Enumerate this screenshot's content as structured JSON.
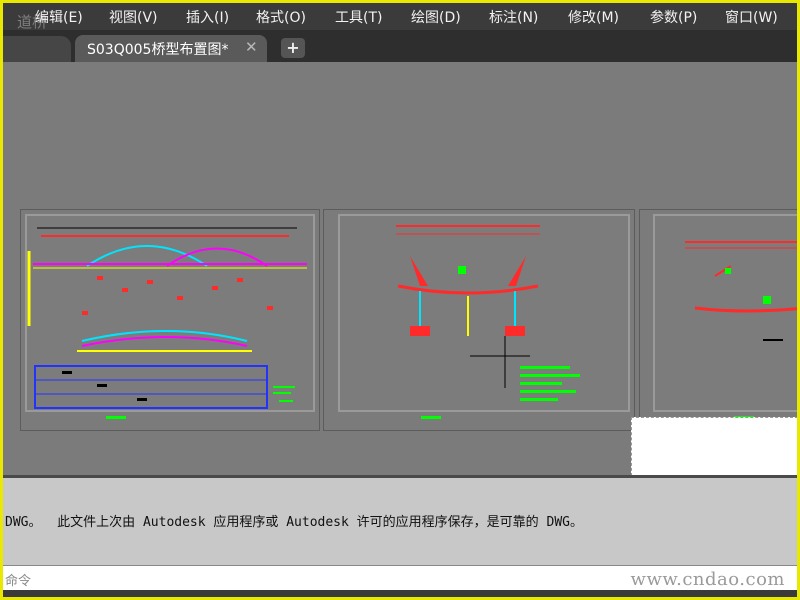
{
  "watermark": "道桥",
  "menu": {
    "items": [
      "编辑(E)",
      "视图(V)",
      "插入(I)",
      "格式(O)",
      "工具(T)",
      "绘图(D)",
      "标注(N)",
      "修改(M)",
      "参数(P)",
      "窗口(W)"
    ]
  },
  "tabs": {
    "active_label": "S03Q005桥型布置图*",
    "close_glyph": "✕",
    "new_glyph": "+"
  },
  "command": {
    "history": "DWG。  此文件上次由 Autodesk 应用程序或 Autodesk 许可的应用程序保存，是可靠的 DWG。",
    "prompt": "命令",
    "site_mark": "www.cndao.com"
  },
  "colors": {
    "menubar": "#3b3b3b",
    "canvas": "#7b7b7b",
    "accent_red": "#ff2a2a",
    "accent_green": "#00ff00",
    "accent_cyan": "#00e5ff",
    "accent_magenta": "#ff00ff",
    "accent_blue": "#2233ff"
  }
}
